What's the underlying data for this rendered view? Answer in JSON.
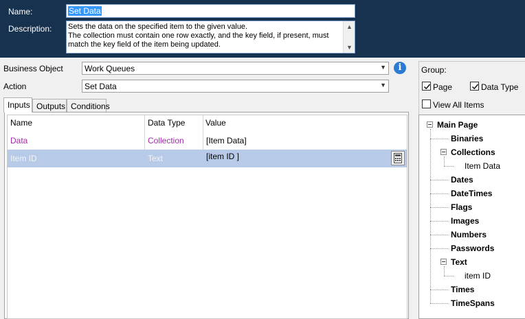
{
  "header": {
    "name_label": "Name:",
    "name_value": "Set Data",
    "description_label": "Description:",
    "description_text": "Sets the data on the specified item to the given value.\nThe collection must contain one row exactly, and the key field, if present, must\nmatch the key field of the item being updated.",
    "description_scroll_up_icon": "chevron-up-icon",
    "description_scroll_down_icon": "chevron-down-icon"
  },
  "fields": {
    "business_object_label": "Business Object",
    "business_object_value": "Work Queues",
    "action_label": "Action",
    "action_value": "Set Data",
    "info_icon_glyph": "i"
  },
  "tabs": [
    {
      "label": "Inputs",
      "active": true
    },
    {
      "label": "Outputs",
      "active": false
    },
    {
      "label": "Conditions",
      "active": false
    }
  ],
  "grid": {
    "columns": [
      "Name",
      "Data Type",
      "Value"
    ],
    "rows": [
      {
        "name": "Data",
        "type": "Collection",
        "value": "[Item Data]",
        "selected": false
      },
      {
        "name": "Item ID",
        "type": "Text",
        "value": "[item ID ]",
        "selected": true
      }
    ]
  },
  "group": {
    "label": "Group:",
    "page_label": "Page",
    "page_checked": true,
    "datatype_label": "Data Type",
    "datatype_checked": true,
    "view_all_label": "View All Items",
    "view_all_checked": false
  },
  "tree": {
    "root": "Main Page",
    "items": {
      "binaries": "Binaries",
      "collections": "Collections",
      "item_data": "Item Data",
      "dates": "Dates",
      "datetimes": "DateTimes",
      "flags": "Flags",
      "images": "Images",
      "numbers": "Numbers",
      "passwords": "Passwords",
      "text": "Text",
      "item_id": "item ID",
      "times": "Times",
      "timespans": "TimeSpans"
    }
  },
  "colors": {
    "header_bg": "#17324f",
    "selection_row": "#b7cbe9",
    "collection_text": "#a12aa8",
    "info_icon": "#2a7bd3"
  }
}
